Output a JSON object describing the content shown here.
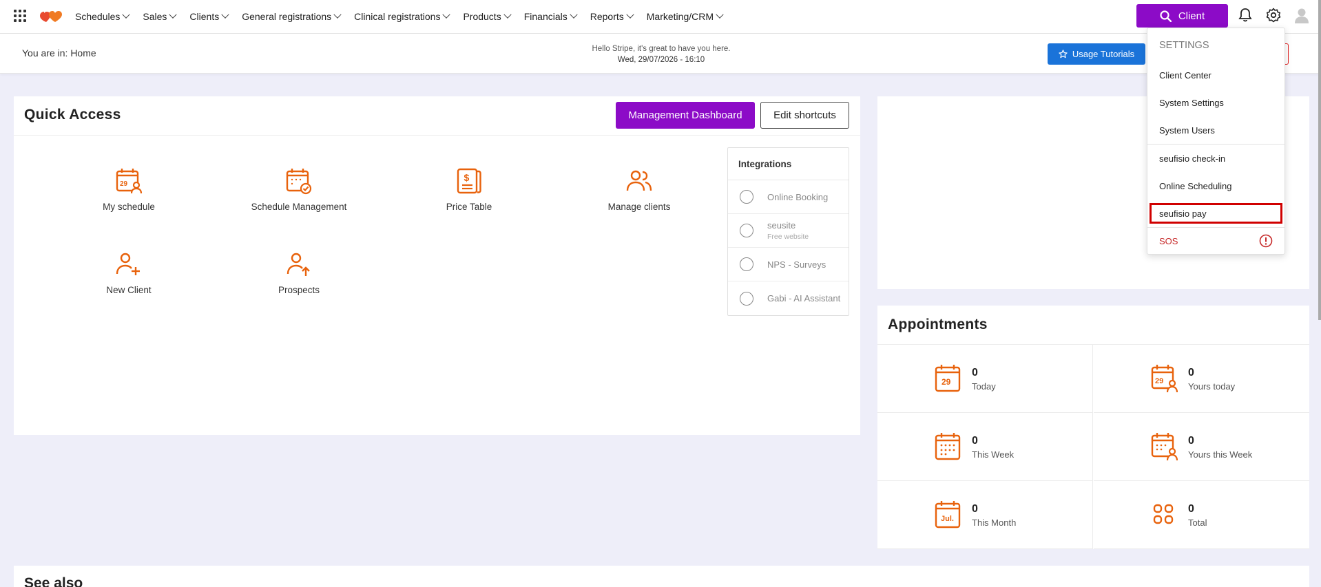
{
  "nav": {
    "menu": [
      "Schedules",
      "Sales",
      "Clients",
      "General registrations",
      "Clinical registrations",
      "Products",
      "Financials",
      "Reports",
      "Marketing/CRM"
    ],
    "client_button": "Client"
  },
  "subheader": {
    "breadcrumb": "You are in: Home",
    "greeting": "Hello Stripe, it's great to have you here.",
    "datetime": "Wed, 29/07/2026 - 16:10",
    "tutorials_button": "Usage Tutorials"
  },
  "quick_access": {
    "title": "Quick Access",
    "dashboard_button": "Management Dashboard",
    "edit_button": "Edit shortcuts",
    "shortcuts": [
      {
        "label": "My schedule",
        "icon": "calendar-person-icon"
      },
      {
        "label": "Schedule Management",
        "icon": "calendar-check-icon"
      },
      {
        "label": "Price Table",
        "icon": "price-document-icon"
      },
      {
        "label": "Manage clients",
        "icon": "users-icon"
      },
      {
        "label": "New Client",
        "icon": "user-plus-icon"
      },
      {
        "label": "Prospects",
        "icon": "user-up-icon"
      }
    ],
    "integrations": {
      "title": "Integrations",
      "items": [
        {
          "label": "Online Booking",
          "sub": ""
        },
        {
          "label": "seusite",
          "sub": "Free website"
        },
        {
          "label": "NPS - Surveys",
          "sub": ""
        },
        {
          "label": "Gabi - AI Assistant",
          "sub": ""
        }
      ]
    }
  },
  "appointments": {
    "title": "Appointments",
    "cells": [
      {
        "value": "0",
        "label": "Today",
        "icon": "calendar-day-icon"
      },
      {
        "value": "0",
        "label": "Yours today",
        "icon": "calendar-day-person-icon"
      },
      {
        "value": "0",
        "label": "This Week",
        "icon": "calendar-week-icon"
      },
      {
        "value": "0",
        "label": "Yours this Week",
        "icon": "calendar-week-person-icon"
      },
      {
        "value": "0",
        "label": "This Month",
        "icon": "calendar-month-icon"
      },
      {
        "value": "0",
        "label": "Total",
        "icon": "grid-total-icon"
      }
    ]
  },
  "see_also": {
    "title": "See also"
  },
  "settings_menu": {
    "header": "SETTINGS",
    "items": [
      "Client Center",
      "System Settings",
      "System Users",
      "seufisio check-in",
      "Online Scheduling",
      "seufisio pay",
      "SOS"
    ]
  },
  "colors": {
    "brand": "#8c0bc7",
    "accent_icon": "#e8620c",
    "tutorials": "#1a73d9",
    "highlight": "#d00000"
  }
}
